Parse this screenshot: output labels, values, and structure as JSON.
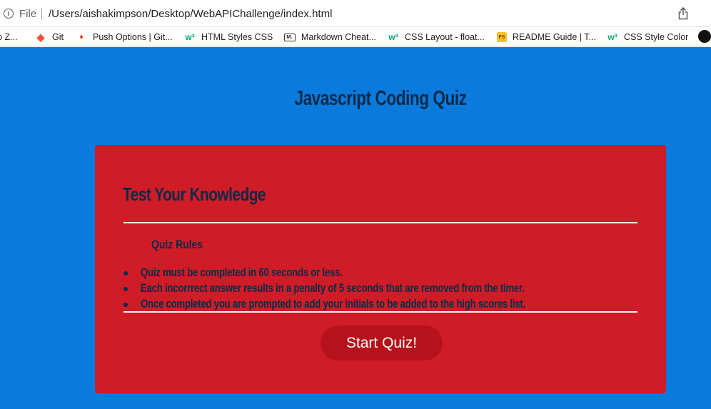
{
  "browser": {
    "info_symbol": "i",
    "file_label": "File",
    "url": "/Users/aishakimpson/Desktop/WebAPIChallenge/index.html",
    "bookmarks": [
      {
        "label": "p Z...",
        "icon": "bookmark-icon"
      },
      {
        "label": "Git",
        "icon": "git-icon"
      },
      {
        "label": "Push Options | Git...",
        "icon": "gitlab-icon"
      },
      {
        "label": "HTML Styles CSS",
        "icon": "w3schools-icon"
      },
      {
        "label": "Markdown Cheat...",
        "icon": "markdown-icon"
      },
      {
        "label": "CSS Layout - float...",
        "icon": "w3schools-icon"
      },
      {
        "label": "README Guide | T...",
        "icon": "fs-icon"
      },
      {
        "label": "CSS Style Color",
        "icon": "w3schools-icon"
      }
    ],
    "bookmark_icon_glyphs": {
      "git": "◆",
      "gitlab": "♦",
      "w3": "w³",
      "markdown": "M↓",
      "fs": "FS"
    }
  },
  "page": {
    "title": "Javascript Coding Quiz",
    "card": {
      "heading": "Test Your Knowledge",
      "rules_title": "Quiz Rules",
      "rules": [
        "Quiz must be completed in 60 seconds or less.",
        "Each incorrrect answer results in a penalty of 5 seconds that are removed from the timer.",
        "Once completed you are prompted to add your initials to be added to the high scores list."
      ],
      "start_button": "Start Quiz!"
    }
  },
  "colors": {
    "background": "#0a7bdc",
    "card": "#cf1c27",
    "button": "#b5121b",
    "text_dark": "#0b2a4a"
  }
}
